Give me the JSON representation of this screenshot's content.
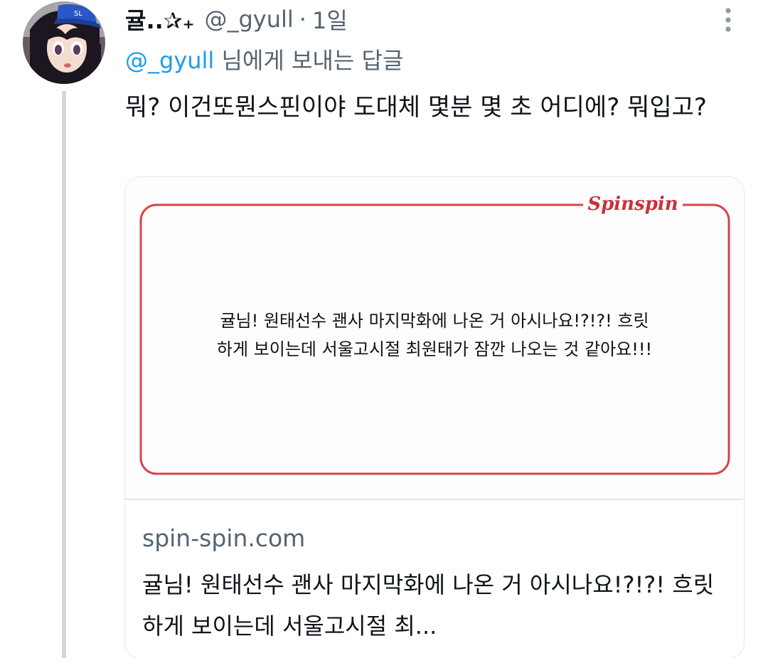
{
  "tweet": {
    "display_name": "귤..✰₊",
    "handle": "@_gyull",
    "separator": "·",
    "time": "1일",
    "reply_to": {
      "mention": "@_gyull",
      "suffix": " 님에게 보내는 답글"
    },
    "text": "뭐? 이건또뭔스핀이야 도대체 몇분 몇 초 어디에? 뭐입고?",
    "more_icon": "vertical-dots-icon"
  },
  "card": {
    "image": {
      "brand": "Spinspin",
      "text": "귤님! 원태선수 괜사 마지막화에 나온 거 아시나요!?!?! 흐릿\n하게 보이는데 서울고시절 최원태가 잠깐 나오는 것 같아요!!!"
    },
    "domain": "spin-spin.com",
    "title": "귤님! 원태선수 괜사 마지막화에 나온 거 아시나요!?!?! 흐릿하게 보이는데 서울고시절 최..."
  },
  "colors": {
    "accent": "#1d9bf0",
    "secondary_text": "#536471",
    "thread_line": "#cfd9de",
    "card_border": "#e1e8ed",
    "brand_red": "#c8323b"
  }
}
